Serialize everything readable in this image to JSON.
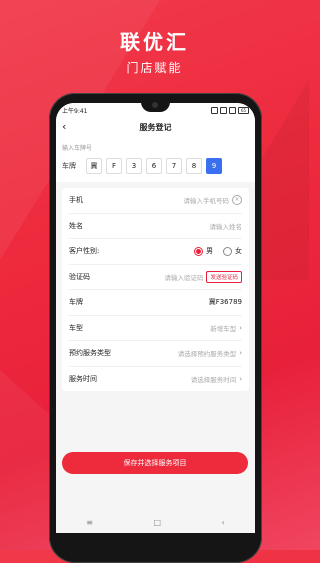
{
  "brand": {
    "title": "联优汇",
    "subtitle": "门店赋能"
  },
  "status_bar": {
    "time": "上午9:41",
    "battery": "65"
  },
  "nav": {
    "back_icon": "chevron-left-icon",
    "title": "服务登记"
  },
  "plate_input": {
    "hint": "输入车牌号",
    "label": "车牌",
    "chars": [
      "冀",
      "F",
      "3",
      "6",
      "7",
      "8",
      "9"
    ],
    "active_index": 6,
    "active_color": "#3a6ff0"
  },
  "form": {
    "phone": {
      "label": "手机",
      "placeholder": "请输入手机号码"
    },
    "name": {
      "label": "姓名",
      "placeholder": "请输入姓名"
    },
    "gender": {
      "label": "客户性别:",
      "male": "男",
      "female": "女",
      "selected": "男"
    },
    "code": {
      "label": "验证码",
      "placeholder": "请输入验证码",
      "button": "发送验证码"
    },
    "plate": {
      "label": "车牌",
      "value": "冀F36789"
    },
    "car_model": {
      "label": "车型",
      "placeholder": "新增车型"
    },
    "service_type": {
      "label": "预约服务类型",
      "placeholder": "请选择预约服务类型"
    },
    "service_time": {
      "label": "服务时间",
      "placeholder": "请选择服务时间"
    }
  },
  "submit_label": "保存并选择服务项目",
  "accent_color": "#ee2a3d",
  "system_nav": {
    "menu": "≡",
    "home": "□",
    "back": "‹"
  }
}
